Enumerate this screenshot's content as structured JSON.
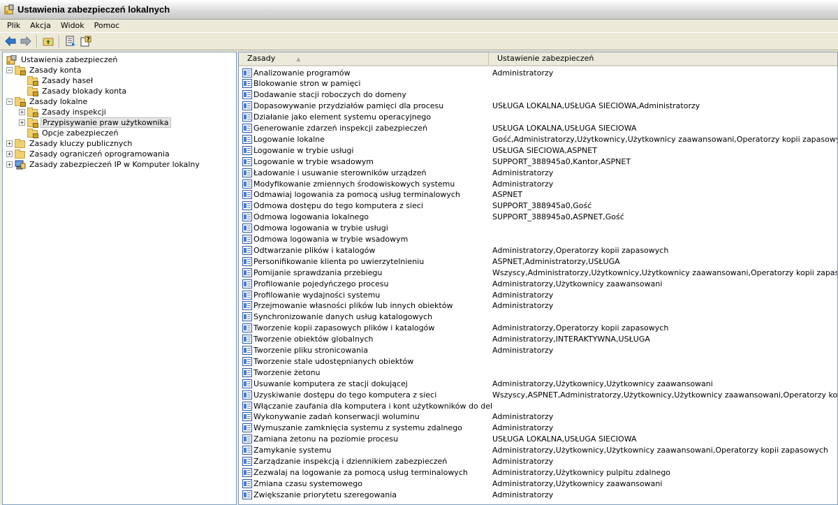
{
  "window": {
    "title": "Ustawienia zabezpieczeń lokalnych"
  },
  "menu": [
    "Plik",
    "Akcja",
    "Widok",
    "Pomoc"
  ],
  "toolbar": {
    "icons": [
      "back-icon",
      "forward-icon",
      "up-folder-icon",
      "export-list-icon",
      "help-icon"
    ]
  },
  "tree": {
    "root": "Ustawienia zabezpieczeń",
    "nodes": [
      {
        "label": "Zasady konta",
        "expander": "−",
        "icon": "lock-folder-icon"
      },
      {
        "label": "Zasady haseł",
        "expander": "",
        "icon": "lock-folder-icon"
      },
      {
        "label": "Zasady blokady konta",
        "expander": "",
        "icon": "lock-folder-icon"
      },
      {
        "label": "Zasady lokalne",
        "expander": "−",
        "icon": "lock-folder-icon"
      },
      {
        "label": "Zasady inspekcji",
        "expander": "+",
        "icon": "lock-folder-icon"
      },
      {
        "label": "Przypisywanie praw użytkownika",
        "expander": "+",
        "icon": "lock-folder-icon"
      },
      {
        "label": "Opcje zabezpieczeń",
        "expander": "",
        "icon": "lock-folder-icon"
      },
      {
        "label": "Zasady kluczy publicznych",
        "expander": "+",
        "icon": "folder-icon"
      },
      {
        "label": "Zasady ograniczeń oprogramowania",
        "expander": "+",
        "icon": "folder-icon"
      },
      {
        "label": "Zasady zabezpieczeń IP w Komputer lokalny",
        "expander": "+",
        "icon": "ip-security-icon"
      }
    ]
  },
  "list": {
    "columns": [
      "Zasady",
      "Ustawienie zabezpieczeń"
    ],
    "rows": [
      [
        "Analizowanie programów",
        "Administratorzy"
      ],
      [
        "Blokowanie stron w pamięci",
        ""
      ],
      [
        "Dodawanie stacji roboczych do domeny",
        ""
      ],
      [
        "Dopasowywanie przydziałów pamięci dla procesu",
        "USŁUGA LOKALNA,USŁUGA SIECIOWA,Administratorzy"
      ],
      [
        "Działanie jako element systemu operacyjnego",
        ""
      ],
      [
        "Generowanie zdarzeń inspekcji zabezpieczeń",
        "USŁUGA LOKALNA,USŁUGA SIECIOWA"
      ],
      [
        "Logowanie lokalne",
        "Gość,Administratorzy,Użytkownicy,Użytkownicy zaawansowani,Operatorzy kopii zapasowych"
      ],
      [
        "Logowanie w trybie usługi",
        "USŁUGA SIECIOWA,ASPNET"
      ],
      [
        "Logowanie w trybie wsadowym",
        "SUPPORT_388945a0,Kantor,ASPNET"
      ],
      [
        "Ładowanie i usuwanie sterowników urządzeń",
        "Administratorzy"
      ],
      [
        "Modyfikowanie zmiennych środowiskowych systemu",
        "Administratorzy"
      ],
      [
        "Odmawiaj logowania za pomocą usług terminalowych",
        "ASPNET"
      ],
      [
        "Odmowa dostępu do tego komputera z sieci",
        "SUPPORT_388945a0,Gość"
      ],
      [
        "Odmowa logowania lokalnego",
        "SUPPORT_388945a0,ASPNET,Gość"
      ],
      [
        "Odmowa logowania w trybie usługi",
        ""
      ],
      [
        "Odmowa logowania w trybie wsadowym",
        ""
      ],
      [
        "Odtwarzanie plików i katalogów",
        "Administratorzy,Operatorzy kopii zapasowych"
      ],
      [
        "Personifikowanie klienta po uwierzytelnieniu",
        "ASPNET,Administratorzy,USŁUGA"
      ],
      [
        "Pomijanie sprawdzania przebiegu",
        "Wszyscy,Administratorzy,Użytkownicy,Użytkownicy zaawansowani,Operatorzy kopii zapasowych"
      ],
      [
        "Profilowanie pojedyńczego procesu",
        "Administratorzy,Użytkownicy zaawansowani"
      ],
      [
        "Profilowanie wydajności systemu",
        "Administratorzy"
      ],
      [
        "Przejmowanie własności plików lub innych obiektów",
        "Administratorzy"
      ],
      [
        "Synchronizowanie danych usług katalogowych",
        ""
      ],
      [
        "Tworzenie kopii zapasowych plików i katalogów",
        "Administratorzy,Operatorzy kopii zapasowych"
      ],
      [
        "Tworzenie obiektów globalnych",
        "Administratorzy,INTERAKTYWNA,USŁUGA"
      ],
      [
        "Tworzenie pliku stronicowania",
        "Administratorzy"
      ],
      [
        "Tworzenie stale udostępnianych obiektów",
        ""
      ],
      [
        "Tworzenie żetonu",
        ""
      ],
      [
        "Usuwanie komputera ze stacji dokującej",
        "Administratorzy,Użytkownicy,Użytkownicy zaawansowani"
      ],
      [
        "Uzyskiwanie dostępu do tego komputera z sieci",
        "Wszyscy,ASPNET,Administratorzy,Użytkownicy,Użytkownicy zaawansowani,Operatorzy kopii zapasowych"
      ],
      [
        "Włączanie zaufania dla komputera i kont użytkowników do delegowania",
        ""
      ],
      [
        "Wykonywanie zadań konserwacji woluminu",
        "Administratorzy"
      ],
      [
        "Wymuszanie zamknięcia systemu z systemu zdalnego",
        "Administratorzy"
      ],
      [
        "Zamiana żetonu na poziomie procesu",
        "USŁUGA LOKALNA,USŁUGA SIECIOWA"
      ],
      [
        "Zamykanie systemu",
        "Administratorzy,Użytkownicy,Użytkownicy zaawansowani,Operatorzy kopii zapasowych"
      ],
      [
        "Zarządzanie inspekcją i dziennikiem zabezpieczeń",
        "Administratorzy"
      ],
      [
        "Zezwalaj na logowanie za pomocą usług terminalowych",
        "Administratorzy,Użytkownicy pulpitu zdalnego"
      ],
      [
        "Zmiana czasu systemowego",
        "Administratorzy,Użytkownicy zaawansowani"
      ],
      [
        "Zwiększanie priorytetu szeregowania",
        "Administratorzy"
      ]
    ]
  }
}
